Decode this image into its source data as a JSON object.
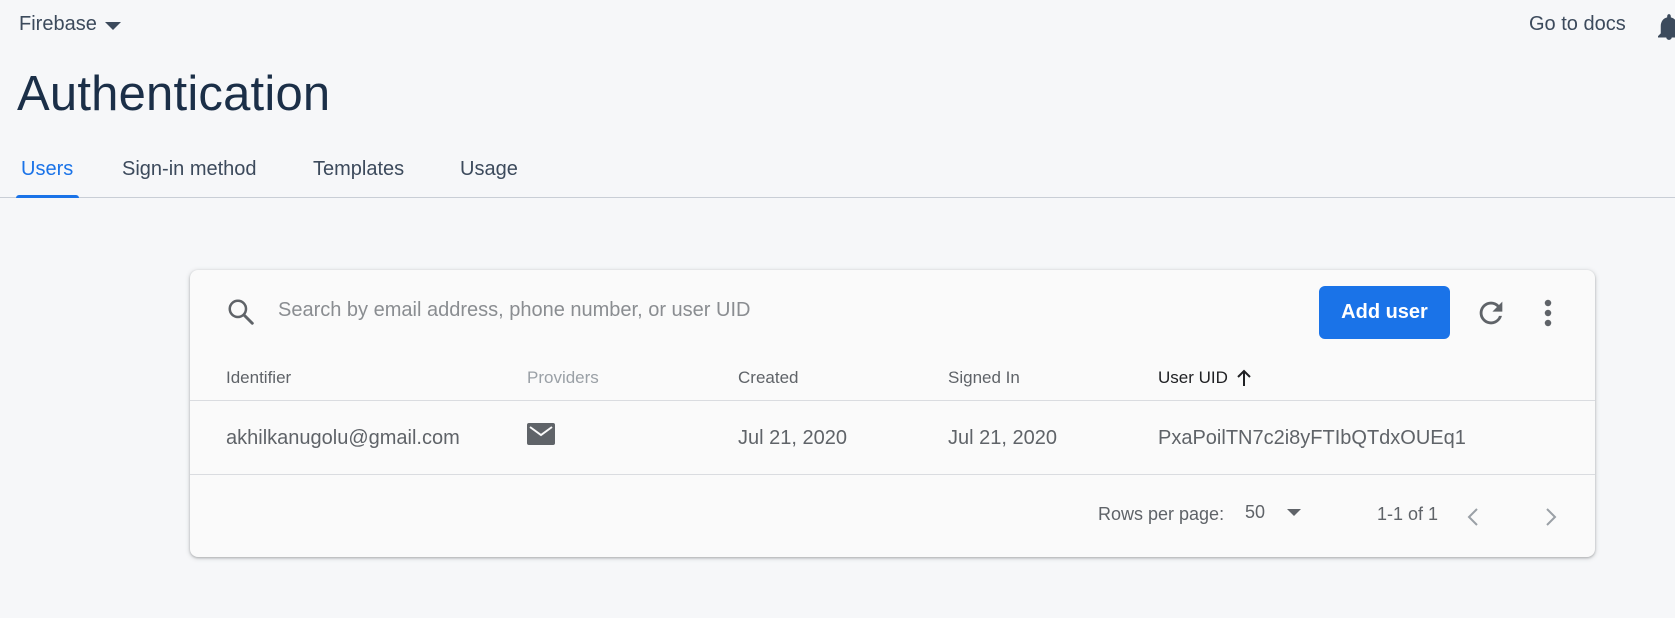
{
  "topbar": {
    "project_name": "Firebase",
    "docs_link": "Go to docs"
  },
  "page": {
    "title": "Authentication"
  },
  "tabs": [
    {
      "label": "Users",
      "active": true
    },
    {
      "label": "Sign-in method",
      "active": false
    },
    {
      "label": "Templates",
      "active": false
    },
    {
      "label": "Usage",
      "active": false
    }
  ],
  "toolbar": {
    "search_placeholder": "Search by email address, phone number, or user UID",
    "add_user_label": "Add user"
  },
  "table": {
    "columns": [
      {
        "label": "Identifier"
      },
      {
        "label": "Providers"
      },
      {
        "label": "Created"
      },
      {
        "label": "Signed In"
      },
      {
        "label": "User UID",
        "sorted": "ascending"
      }
    ],
    "rows": [
      {
        "identifier": "akhilkanugolu@gmail.com",
        "provider_icon": "mail-icon",
        "created": "Jul 21, 2020",
        "signed_in": "Jul 21, 2020",
        "uid": "PxaPoilTN7c2i8yFTIbQTdxOUEq1"
      }
    ]
  },
  "pagination": {
    "rows_per_page_label": "Rows per page:",
    "rows_per_page_value": "50",
    "range_label": "1-1 of 1"
  },
  "colors": {
    "accent": "#1a73e8",
    "title": "#1b2f48",
    "background": "#f6f7f9"
  },
  "icons": [
    "chevron-down-icon",
    "bell-icon",
    "search-icon",
    "refresh-icon",
    "more-vert-icon",
    "arrow-up-icon",
    "mail-icon",
    "chevron-left-icon",
    "chevron-right-icon"
  ]
}
